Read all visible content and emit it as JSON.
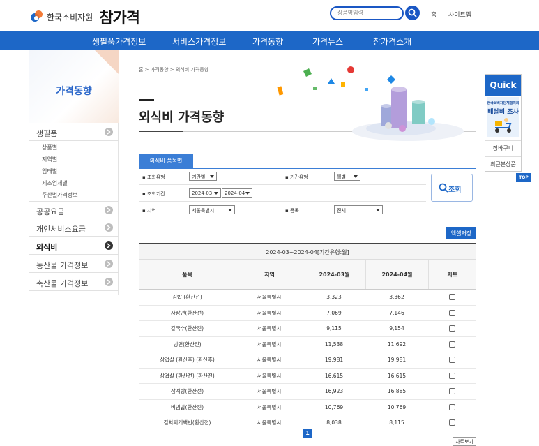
{
  "header": {
    "org_name": "한국소비자원",
    "brand_name": "참가격",
    "search_placeholder": "상품명입력",
    "home_link": "홈",
    "sitemap_link": "사이트맵",
    "util_separator": "|"
  },
  "gnb": [
    "생필품가격정보",
    "서비스가격정보",
    "가격동향",
    "가격뉴스",
    "참가격소개"
  ],
  "lnb": {
    "title": "가격동향",
    "sections": [
      {
        "label": "생필품",
        "active": false,
        "sub": [
          "상품별",
          "지역별",
          "업태별",
          "제조업체별",
          "주산별가격정보"
        ]
      },
      {
        "label": "공공요금",
        "active": false
      },
      {
        "label": "개인서비스요금",
        "active": false
      },
      {
        "label": "외식비",
        "active": true
      },
      {
        "label": "농산물 가격정보",
        "active": false
      },
      {
        "label": "축산물 가격정보",
        "active": false
      }
    ]
  },
  "breadcrumb": "홈 > 가격동향 > 외식비 가격동향",
  "page_title": "외식비 가격동향",
  "tab_label": "외식비 품목별",
  "filter": {
    "search_type_label": "▪ 조회유형",
    "search_type_value": "기간별",
    "period_type_label": "▪ 기간유형",
    "period_type_value": "월별",
    "period_label": "▪ 조회기간",
    "period_from": "2024-03",
    "period_to": "2024-04",
    "region_label": "▪ 지역",
    "region_value": "서울특별시",
    "item_label": "▪ 품목",
    "item_value": "전체",
    "query_button": "조회"
  },
  "excel_button": "액셀저장",
  "table": {
    "caption": "2024-03~2024-04[기간유형:월]",
    "headers": [
      "품목",
      "지역",
      "2024-03월",
      "2024-04월",
      "차트"
    ],
    "rows": [
      [
        "김밥 (환산전)",
        "서울특별시",
        "3,323",
        "3,362"
      ],
      [
        "자장면(환산전)",
        "서울특별시",
        "7,069",
        "7,146"
      ],
      [
        "칼국수(환산전)",
        "서울특별시",
        "9,115",
        "9,154"
      ],
      [
        "냉면(환산전)",
        "서울특별시",
        "11,538",
        "11,692"
      ],
      [
        "삼겹살 (환산후) (환산후)",
        "서울특별시",
        "19,981",
        "19,981"
      ],
      [
        "삼겹살 (환산전) (환산전)",
        "서울특별시",
        "16,615",
        "16,615"
      ],
      [
        "삼계탕(환산전)",
        "서울특별시",
        "16,923",
        "16,885"
      ],
      [
        "비빔밥(환산전)",
        "서울특별시",
        "10,769",
        "10,769"
      ],
      [
        "김치찌개백반(환산전)",
        "서울특별시",
        "8,038",
        "8,115"
      ]
    ]
  },
  "pagination": {
    "current": "1"
  },
  "chart_button": "차트보기",
  "quick": {
    "title": "Quick",
    "banner_org": "한국소비자단체협의회",
    "banner_title": "배달비 조사",
    "items": [
      "장바구니",
      "최근본상품"
    ],
    "top": "TOP"
  },
  "colors": {
    "primary": "#1d67c7",
    "accent_light": "#3b7ed6"
  }
}
